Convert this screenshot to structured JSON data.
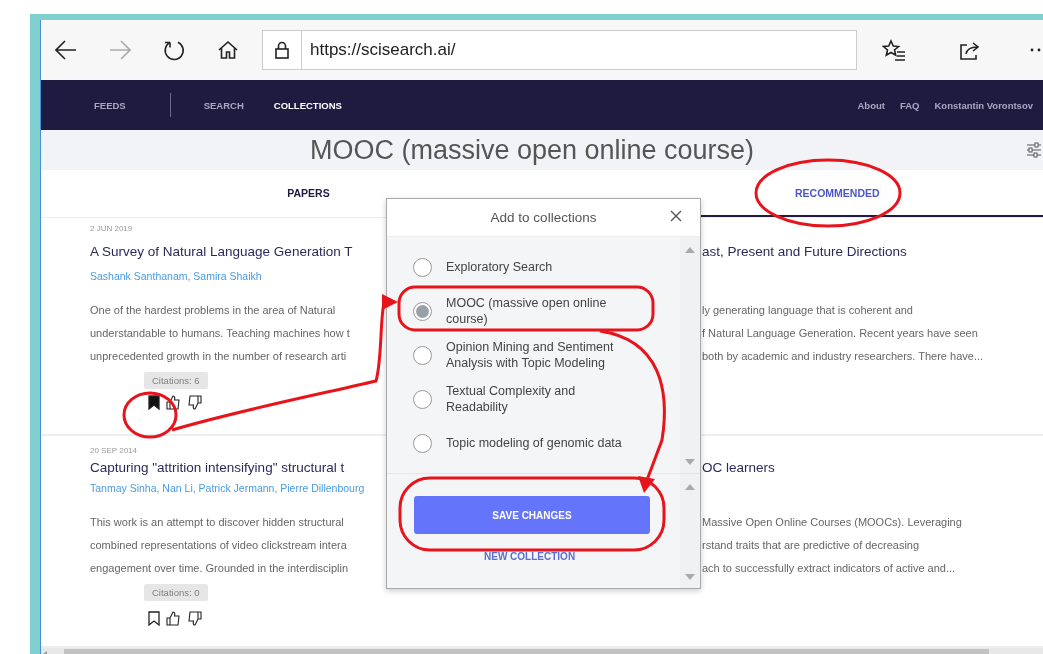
{
  "browser": {
    "url": "https://scisearch.ai/",
    "forward_disabled": true
  },
  "nav": {
    "items": [
      {
        "label": "FEEDS",
        "selected": false
      },
      {
        "label": "SEARCH",
        "selected": false
      },
      {
        "label": "COLLECTIONS",
        "selected": true
      }
    ],
    "links": [
      "About",
      "FAQ",
      "Konstantin Vorontsov"
    ]
  },
  "page_title": "MOOC (massive open online course)",
  "tabs": [
    {
      "label": "PAPERS",
      "selected": false
    },
    {
      "label": "RECOMMENDED",
      "selected": true
    }
  ],
  "papers": [
    {
      "date": "2 JUN 2019",
      "title": {
        "left": "A Survey of Natural Language Generation T",
        "right": "ast, Present and Future Directions"
      },
      "authors": "Sashank Santhanam, Samira Shaikh",
      "abstract": [
        {
          "left": "One of the hardest problems in the area of Natural",
          "right": "ly generating language that is coherent and"
        },
        {
          "left": "understandable to humans. Teaching machines how t",
          "right": "f Natural Language Generation. Recent years have seen"
        },
        {
          "left": "unprecedented growth in the number of research arti",
          "right": "both by academic and industry researchers. There have..."
        }
      ],
      "citations": "Citations: 6",
      "bookmarked": true
    },
    {
      "date": "20 SEP 2014",
      "title": {
        "left": "Capturing \"attrition intensifying\" structural t",
        "right": "OC learners"
      },
      "authors": "Tanmay Sinha, Nan Li, Patrick Jermann, Pierre Dillenbourg",
      "abstract": [
        {
          "left": "This work is an attempt to discover hidden structural",
          "right": "Massive Open Online Courses (MOOCs). Leveraging"
        },
        {
          "left": "combined representations of video clickstream intera",
          "right": "rstand traits that are predictive of decreasing"
        },
        {
          "left": "engagement over time. Grounded in the interdisciplin",
          "right": "ach to successfully extract indicators of active and..."
        }
      ],
      "citations": "Citations: 0",
      "bookmarked": false
    }
  ],
  "dialog": {
    "title": "Add to collections",
    "collections": [
      {
        "label": "Exploratory Search",
        "selected": false
      },
      {
        "label": "MOOC (massive open online course)",
        "selected": true
      },
      {
        "label": "Opinion Mining and Sentiment Analysis with Topic Modeling",
        "selected": false
      },
      {
        "label": "Textual Complexity and Readability",
        "selected": false
      },
      {
        "label": "Topic modeling of genomic data",
        "selected": false
      }
    ],
    "save_button": "SAVE CHANGES",
    "new_collection": "NEW COLLECTION"
  }
}
